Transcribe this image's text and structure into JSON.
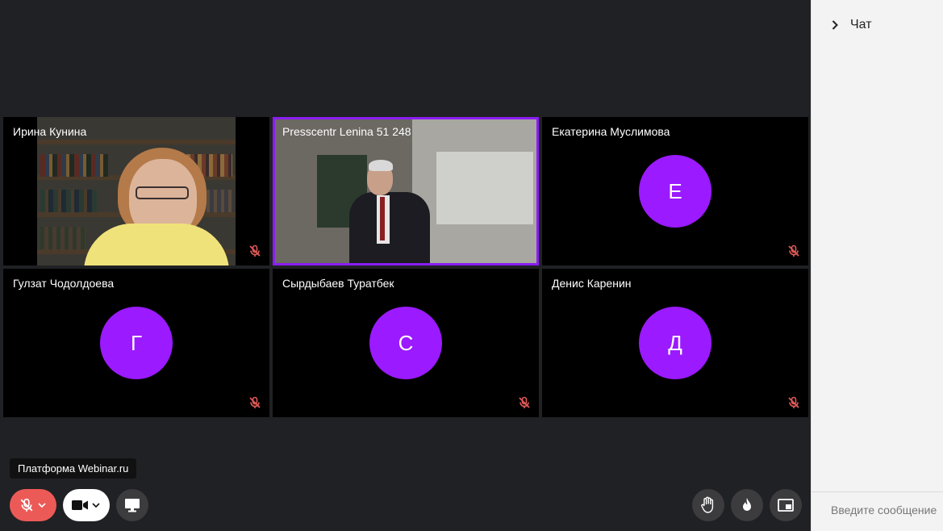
{
  "participants": [
    {
      "name": "Ирина Кунина",
      "initial": "",
      "muted": true
    },
    {
      "name": "Presscentr Lenina 51 248",
      "initial": "",
      "muted": false,
      "active_speaker": true
    },
    {
      "name": "Екатерина Муслимова",
      "initial": "Е",
      "muted": true
    },
    {
      "name": "Гулзат Чодолдоева",
      "initial": "Г",
      "muted": true
    },
    {
      "name": "Сырдыбаев Туратбек",
      "initial": "С",
      "muted": true
    },
    {
      "name": "Денис Каренин",
      "initial": "Д",
      "muted": true
    }
  ],
  "tooltip": {
    "text": "Платформа Webinar.ru"
  },
  "controls": {
    "mic": {
      "icon": "mic-off-icon",
      "state": "off"
    },
    "camera": {
      "icon": "camera-icon",
      "state": "on"
    },
    "screen_share": {
      "icon": "monitor-icon"
    },
    "raise_hand": {
      "icon": "hand-icon"
    },
    "reactions": {
      "icon": "fire-icon"
    },
    "picture_in_picture": {
      "icon": "pip-icon"
    }
  },
  "chat": {
    "title": "Чат",
    "input_placeholder": "Введите сообщение"
  },
  "colors": {
    "background": "#202124",
    "avatar": "#9b1aff",
    "active_border": "#8a1df2",
    "mic_off_red": "#ec5a57",
    "chat_panel": "#f3f3f3"
  }
}
